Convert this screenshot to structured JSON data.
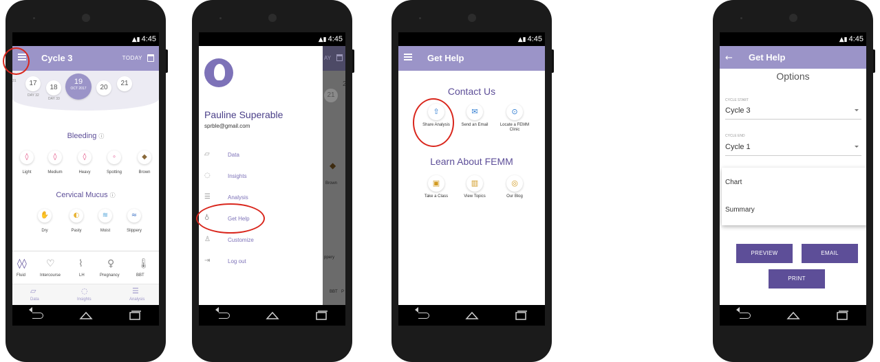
{
  "status": {
    "time": "4:45"
  },
  "screen1": {
    "app_title": "Cycle 3",
    "today_label": "TODAY",
    "days": [
      {
        "num": "17",
        "sub": "DAY 32"
      },
      {
        "num": "18",
        "sub": "DAY 33"
      },
      {
        "num": "19",
        "sub": "OCT 2017"
      },
      {
        "num": "20",
        "sub": ""
      },
      {
        "num": "21",
        "sub": ""
      }
    ],
    "edge_left_sub": "31",
    "bleeding_title": "Bleeding",
    "bleeding": [
      "Light",
      "Medium",
      "Heavy",
      "Spotting",
      "Brown"
    ],
    "mucus_title": "Cervical Mucus",
    "mucus": [
      "Dry",
      "Pasty",
      "Moist",
      "Slippery"
    ],
    "trackers": [
      "Fluid",
      "Intercourse",
      "LH",
      "Pregnancy",
      "BBT"
    ],
    "bottom_nav": [
      "Data",
      "Insights",
      "Analysis"
    ]
  },
  "screen2": {
    "user_name": "Pauline Superable",
    "user_email": "sprble@gmail.com",
    "menu": [
      "Data",
      "Insights",
      "Analysis",
      "Get Help",
      "Customize",
      "Log out"
    ],
    "peek_day": "21",
    "peek_day2": "2",
    "peek_today": "AY",
    "peek_brown": "Brown",
    "peek_slippery": "ppery",
    "peek_bbt": "BBT",
    "peek_p": "P"
  },
  "screen3": {
    "app_title": "Get Help",
    "contact_title": "Contact Us",
    "contact_actions": [
      "Share Analysis",
      "Send an Email",
      "Locate a FEMM Clinic"
    ],
    "learn_title": "Learn About FEMM",
    "learn_actions": [
      "Take a Class",
      "View Topics",
      "Our Blog"
    ]
  },
  "screen4": {
    "app_title": "Get Help",
    "options_title": "Options",
    "cycle_start_label": "CYCLE START",
    "cycle_start_value": "Cycle 3",
    "cycle_end_label": "CYCLE END",
    "cycle_end_value": "Cycle 1",
    "menu_items": [
      "Chart",
      "Summary"
    ],
    "preview_label": "PREVIEW",
    "email_label": "EMAIL",
    "print_label": "PRINT"
  }
}
